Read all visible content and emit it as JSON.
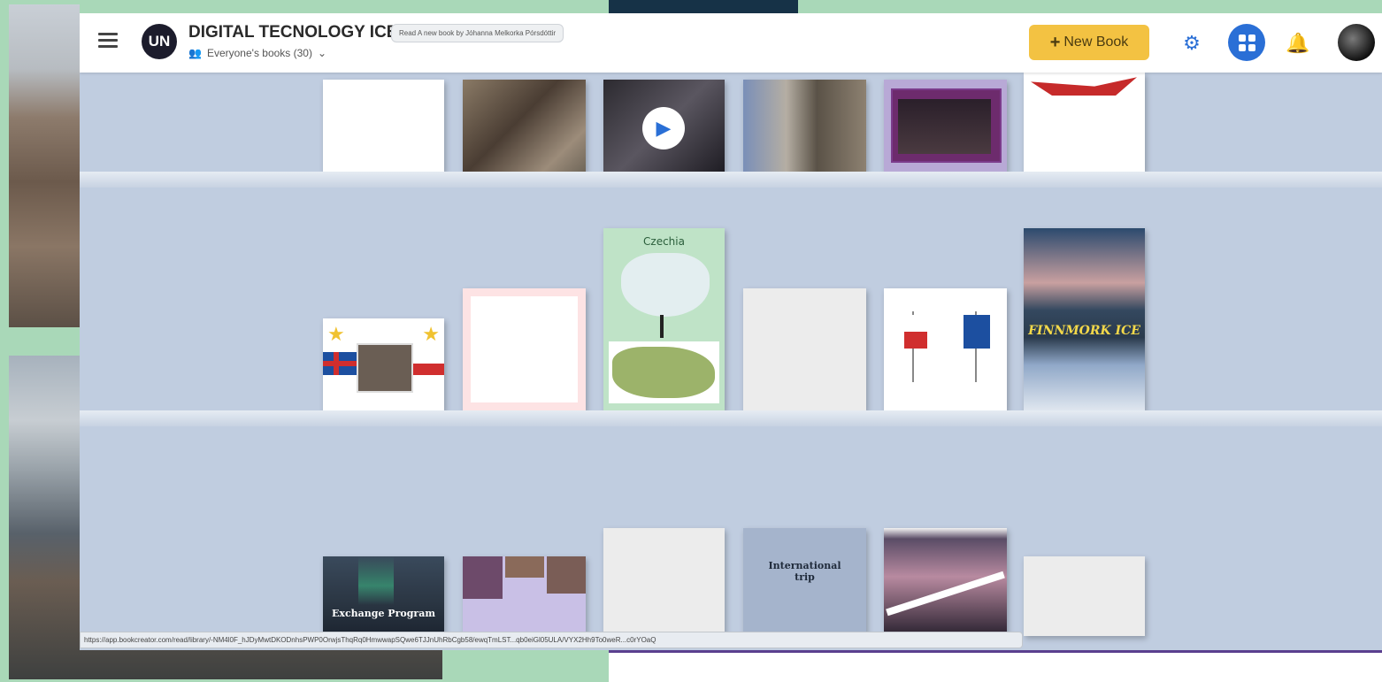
{
  "header": {
    "library_initials": "UN",
    "library_title": "DIGITAL TECNOLOGY ICE",
    "library_subtitle": "Everyone's books (30)",
    "tooltip": "Read A new book by Jóhanna Melkorka Pórsdóttir",
    "new_book_label": "New Book"
  },
  "books": {
    "czechia_title": "Czechia",
    "finnmork_title": "FINNMORK ICE",
    "international_title": "International trip",
    "exchange_title": "Exchange Program"
  },
  "status_url": "https://app.bookcreator.com/read/library/-NM4l0F_hJDyMwtDKODnhsPWP0OrwjsThqRq0HmwwapSQwe6TJJnUhRbCgb58/ewqTmLST...qb0eiGl05ULA/VYX2Hh9To0weR...c0rYOaQ",
  "colors": {
    "accent": "#2a6fd6",
    "new_book": "#f3c242",
    "background": "#c0cde0"
  },
  "icons": [
    "menu-icon",
    "people-icon",
    "chevron-down-icon",
    "plus-icon",
    "gear-icon",
    "grid-icon",
    "bell-icon",
    "play-icon"
  ]
}
